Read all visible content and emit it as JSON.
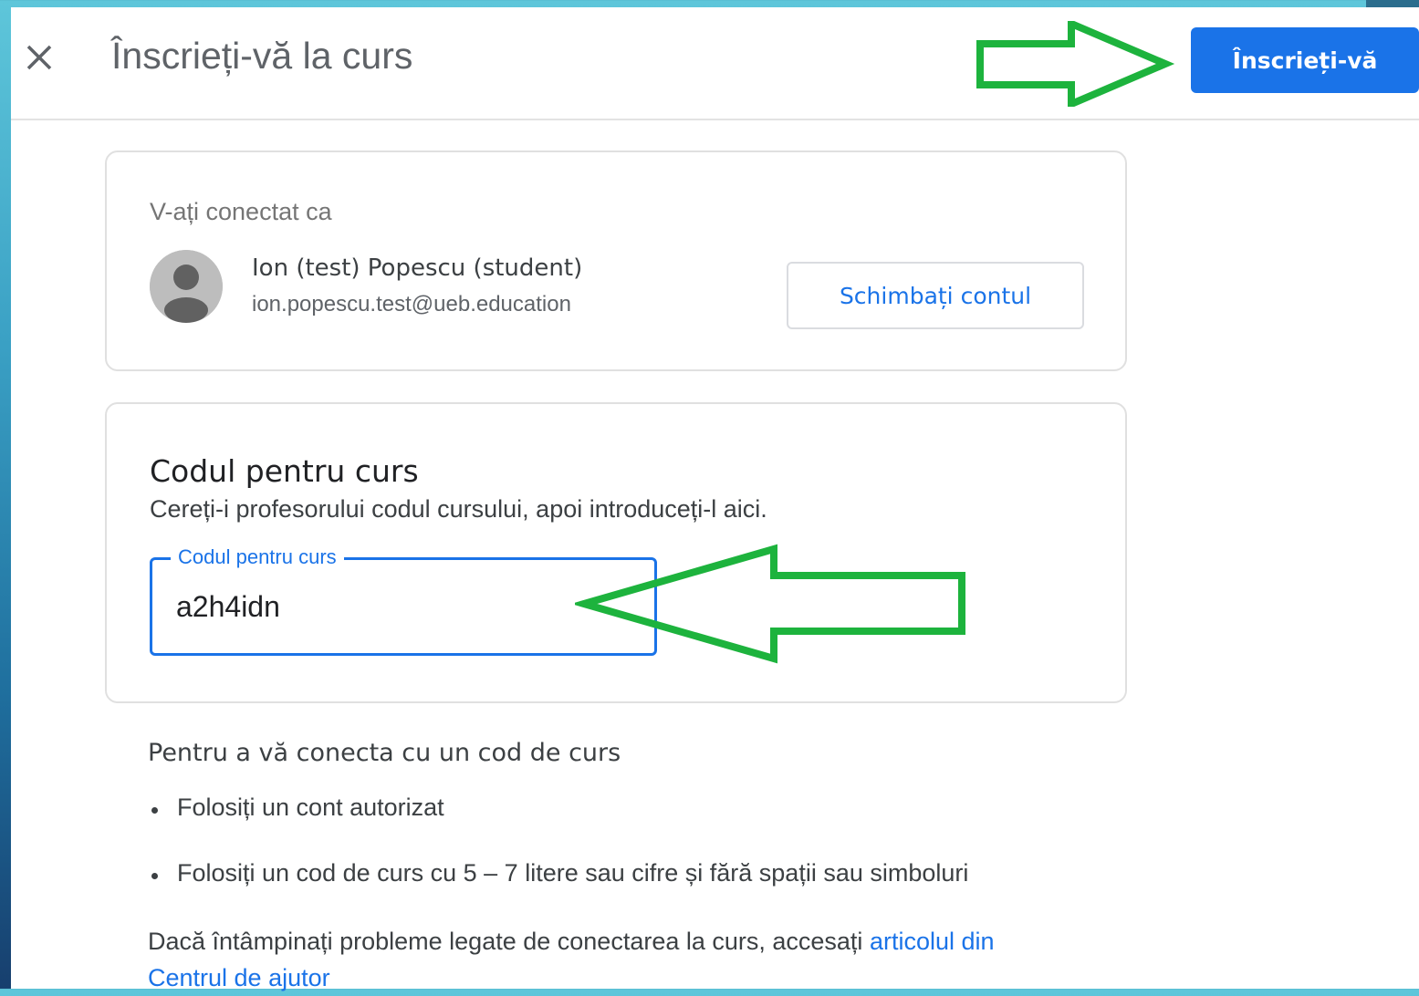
{
  "header": {
    "title": "Înscrieți-vă la curs",
    "close_icon": "close-icon",
    "join_label": "Înscrieți-vă"
  },
  "account": {
    "signed_in_label": "V-ați conectat ca",
    "name": "Ion (test) Popescu (student)",
    "email": "ion.popescu.test@ueb.education",
    "switch_label": "Schimbați contul",
    "avatar_icon": "person-avatar-icon"
  },
  "course_code": {
    "heading": "Codul pentru curs",
    "description": "Cereți-i profesorului codul cursului, apoi introduceți-l aici.",
    "field_label": "Codul pentru curs",
    "value": "a2h4idn"
  },
  "help": {
    "heading": "Pentru a vă conecta cu un cod de curs",
    "items": [
      "Folosiți un cont autorizat",
      "Folosiți un cod de curs cu 5 – 7 litere sau cifre și fără spații sau simboluri"
    ],
    "footer_text": "Dacă întâmpinați probleme legate de conectarea la curs, accesați ",
    "footer_link": "articolul din Centrul de ajutor"
  },
  "annotations": {
    "arrow_color": "#1db33d"
  },
  "colors": {
    "primary": "#1a73e8",
    "text": "#3c4043"
  }
}
